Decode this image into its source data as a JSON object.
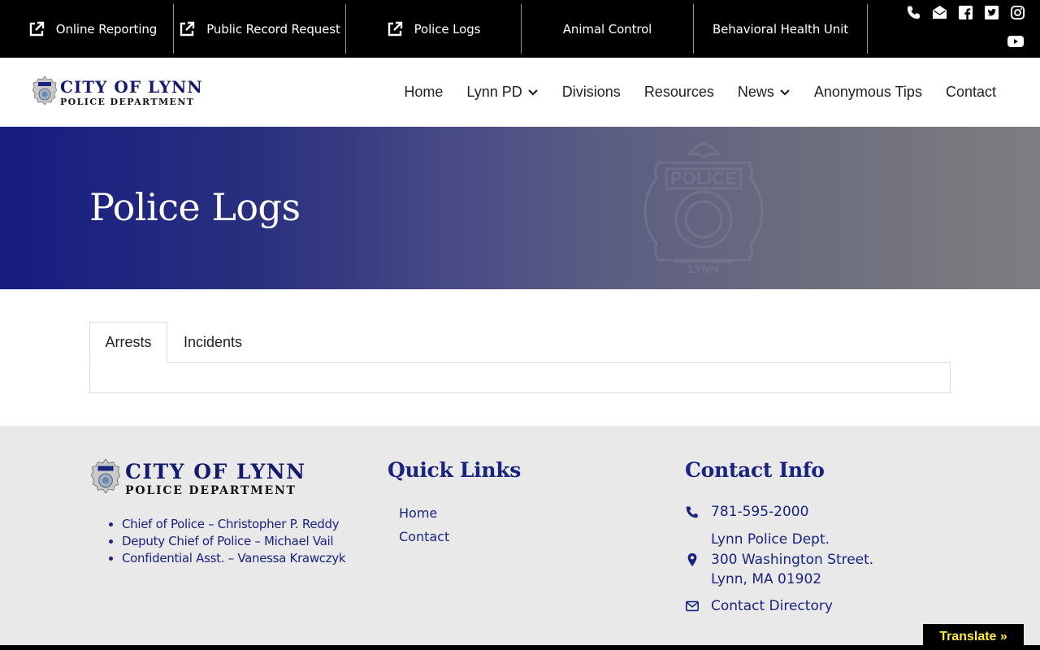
{
  "topbar": {
    "links": [
      {
        "label": "Online Reporting",
        "icon": "external-link-icon"
      },
      {
        "label": "Public Record Request",
        "icon": "external-link-icon"
      },
      {
        "label": "Police Logs",
        "icon": "external-link-icon"
      },
      {
        "label": "Animal Control"
      },
      {
        "label": "Behavioral Health Unit"
      }
    ],
    "social": [
      "phone-icon",
      "envelope-icon",
      "facebook-icon",
      "twitter-icon",
      "instagram-icon",
      "youtube-icon"
    ]
  },
  "logo": {
    "line1": "CITY OF LYNN",
    "line2": "POLICE DEPARTMENT"
  },
  "nav": {
    "items": [
      {
        "label": "Home"
      },
      {
        "label": "Lynn PD",
        "dropdown": true
      },
      {
        "label": "Divisions"
      },
      {
        "label": "Resources"
      },
      {
        "label": "News",
        "dropdown": true
      },
      {
        "label": "Anonymous Tips"
      },
      {
        "label": "Contact"
      }
    ]
  },
  "hero": {
    "title": "Police Logs",
    "badge_top": "POLICE",
    "badge_bottom": "LYNN"
  },
  "tabs": [
    {
      "label": "Arrests",
      "active": true
    },
    {
      "label": "Incidents",
      "active": false
    }
  ],
  "footer": {
    "logo": {
      "line1": "CITY OF LYNN",
      "line2": "POLICE DEPARTMENT"
    },
    "staff": [
      "Chief of Police – Christopher P. Reddy",
      "Deputy Chief of Police – Michael Vail",
      "Confidential Asst. – Vanessa Krawczyk"
    ],
    "quick_links": {
      "heading": "Quick Links",
      "items": [
        "Home",
        "Contact"
      ]
    },
    "contact": {
      "heading": "Contact Info",
      "phone": "781-595-2000",
      "address": [
        "Lynn Police Dept.",
        "300 Washington Street.",
        "Lynn, MA 01902"
      ],
      "directory": "Contact Directory"
    }
  },
  "translate": {
    "label": "Translate »"
  },
  "colors": {
    "brand_navy": "#1a237e",
    "topbar_bg": "#000000",
    "footer_bg": "#e9e9e9",
    "translate_text": "#ffea3a"
  }
}
